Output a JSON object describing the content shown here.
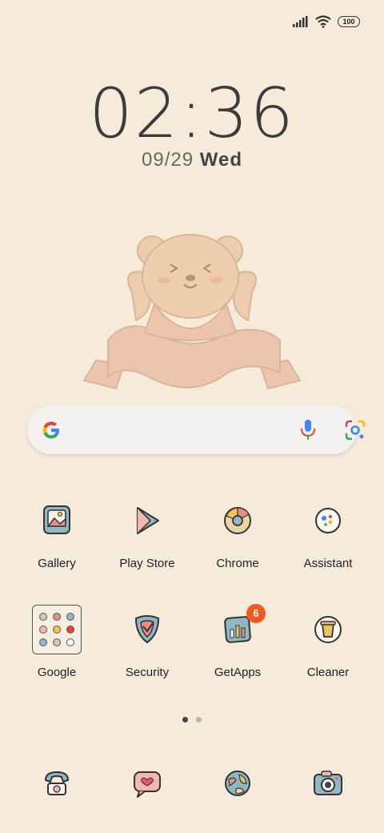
{
  "status": {
    "battery": "100"
  },
  "lockscreen": {
    "time": "02:36",
    "date": "09/29",
    "weekday": "Wed"
  },
  "colors": {
    "background": "#f6eadb",
    "badge": "#f15a1f",
    "icon_blue": "#8fb7c4",
    "icon_pink": "#f2b7b0"
  },
  "apps": [
    {
      "label": "Gallery",
      "icon": "gallery-icon"
    },
    {
      "label": "Play Store",
      "icon": "play-store-icon"
    },
    {
      "label": "Chrome",
      "icon": "chrome-icon"
    },
    {
      "label": "Assistant",
      "icon": "assistant-icon"
    },
    {
      "label": "Google",
      "icon": "folder-icon"
    },
    {
      "label": "Security",
      "icon": "security-icon"
    },
    {
      "label": "GetApps",
      "icon": "getapps-icon",
      "badge": "6"
    },
    {
      "label": "Cleaner",
      "icon": "cleaner-icon"
    }
  ],
  "dock": [
    {
      "icon": "phone-icon"
    },
    {
      "icon": "messages-icon"
    },
    {
      "icon": "browser-globe-icon"
    },
    {
      "icon": "camera-icon"
    }
  ],
  "page_indicator": {
    "pages": 2,
    "current": 1
  }
}
